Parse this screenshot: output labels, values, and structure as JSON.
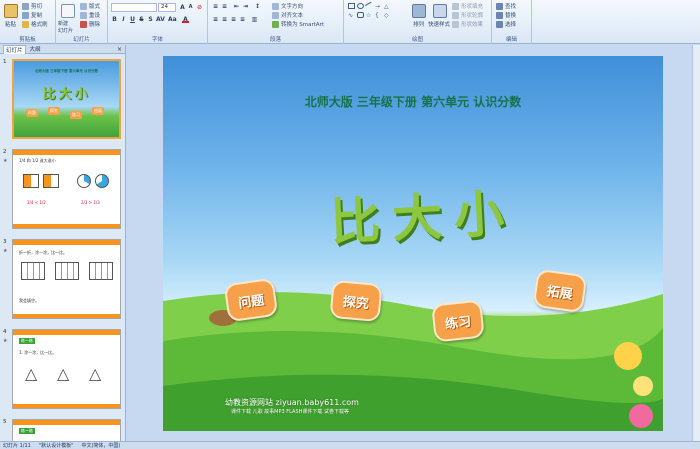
{
  "ribbon": {
    "clipboard": {
      "paste": "粘贴",
      "cut": "剪切",
      "copy": "复制",
      "format_painter": "格式刷",
      "label": "剪贴板"
    },
    "slides": {
      "new_slide": "新建\n幻灯片",
      "layout": "版式",
      "reset": "重设",
      "delete": "删除",
      "label": "幻灯片"
    },
    "font": {
      "font_name": "",
      "font_size": "24",
      "label": "字体"
    },
    "paragraph": {
      "text_direction": "文字方向",
      "align_text": "对齐文本",
      "smartart": "转换为 SmartArt",
      "label": "段落"
    },
    "drawing": {
      "arrange": "排列",
      "quick_styles": "快速样式",
      "shape_fill": "形状填充",
      "shape_outline": "形状轮廓",
      "shape_effects": "形状效果",
      "label": "绘图"
    },
    "editing": {
      "find": "查找",
      "replace": "替换",
      "select": "选择",
      "label": "编辑"
    }
  },
  "pane": {
    "tab_outline": "幻灯片",
    "tab_slides": "大纲",
    "close": "×"
  },
  "thumbnails": [
    {
      "num": "1",
      "title": "北师大版 三年级下册 第六单元 认识分数",
      "big": "比大小",
      "buttons": [
        "问题",
        "探究",
        "练习",
        "拓展"
      ]
    },
    {
      "num": "2",
      "line1": "1/4 和 1/2 谁大谁小",
      "cmp1": "1/4 < 1/2",
      "cmp2": "2/3 > 1/3"
    },
    {
      "num": "3",
      "line1": "折一折，涂一涂，比一比。",
      "line2": "我会填空。"
    },
    {
      "num": "4",
      "header": "练一练",
      "line1": "1. 涂一涂，比一比。"
    },
    {
      "num": "5",
      "header": "练一练"
    }
  ],
  "slide": {
    "title": "北师大版  三年级下册  第六单元    认识分数",
    "big_title": "比大小",
    "buttons": [
      "问题",
      "探究",
      "练习",
      "拓展"
    ],
    "site": "幼教资源网站  ziyuan.baby611.com",
    "links": "课件下载  儿歌  故事MP3  FLASH课件下载  试卷下载等"
  },
  "status": {
    "slide_info": "幻灯片 1/11",
    "theme": "\"默认设计模板\"",
    "language": "中文(简体，中国)"
  }
}
